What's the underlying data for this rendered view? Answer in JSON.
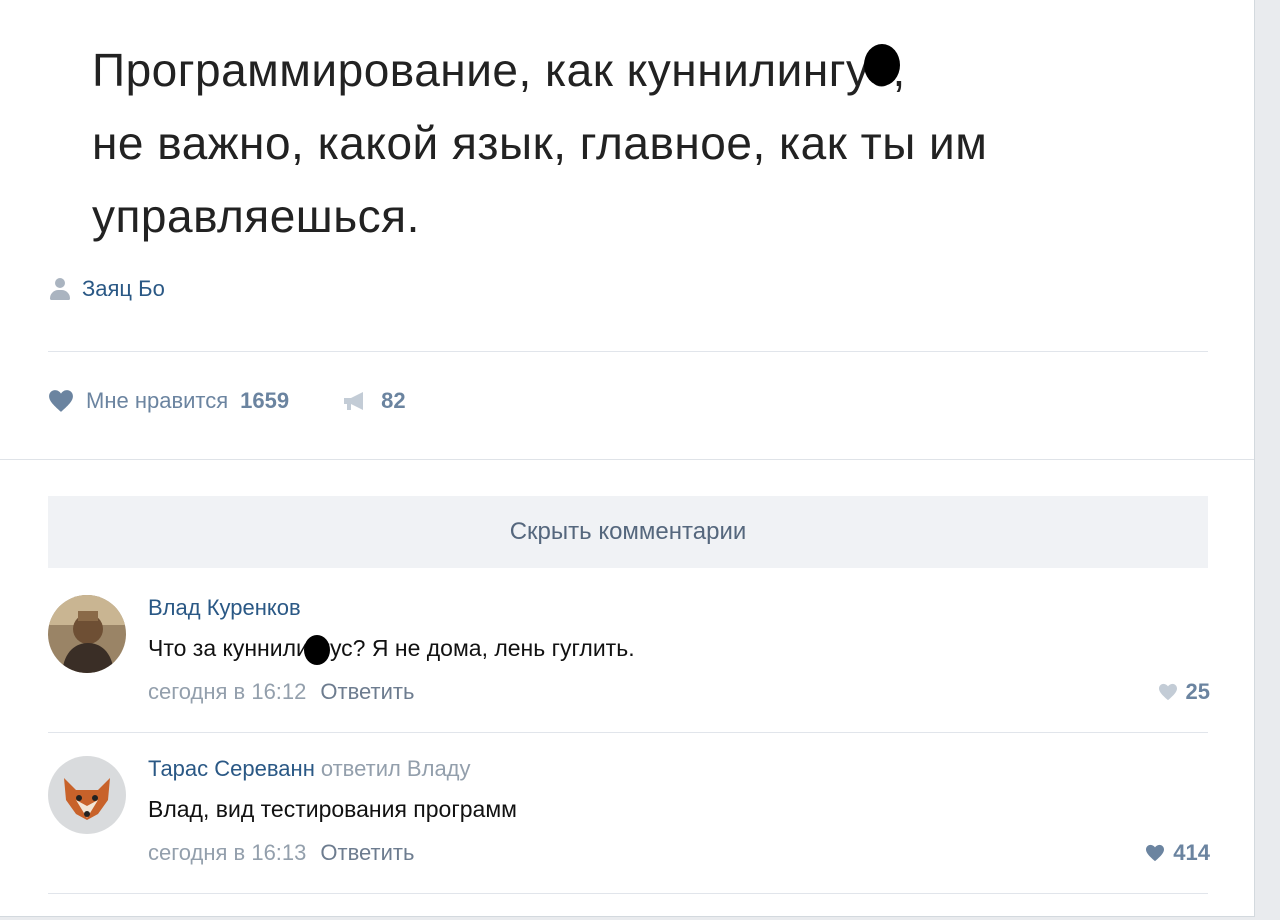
{
  "post": {
    "text": "Программирование, как куннилингус,\nне важно, какой язык, главное, как ты им\nуправляешься.",
    "author": "Заяц Бо",
    "likes_label": "Мне нравится",
    "likes_count": "1659",
    "shares_count": "82"
  },
  "hide_comments_label": "Скрыть комментарии",
  "comments": [
    {
      "author": "Влад Куренков",
      "reply_note": "",
      "text": "Что за куннилингус? Я не дома, лень гуглить.",
      "time": "сегодня в 16:12",
      "reply_label": "Ответить",
      "likes": "25",
      "like_color": "#c3ccd6"
    },
    {
      "author": "Тарас Сереванн",
      "reply_note": "ответил Владу",
      "text": "Влад, вид тестирования программ",
      "time": "сегодня в 16:13",
      "reply_label": "Ответить",
      "likes": "414",
      "like_color": "#6b84a0"
    }
  ],
  "colors": {
    "link": "#2a5885",
    "muted": "#939fac",
    "accent": "#6b84a0"
  }
}
